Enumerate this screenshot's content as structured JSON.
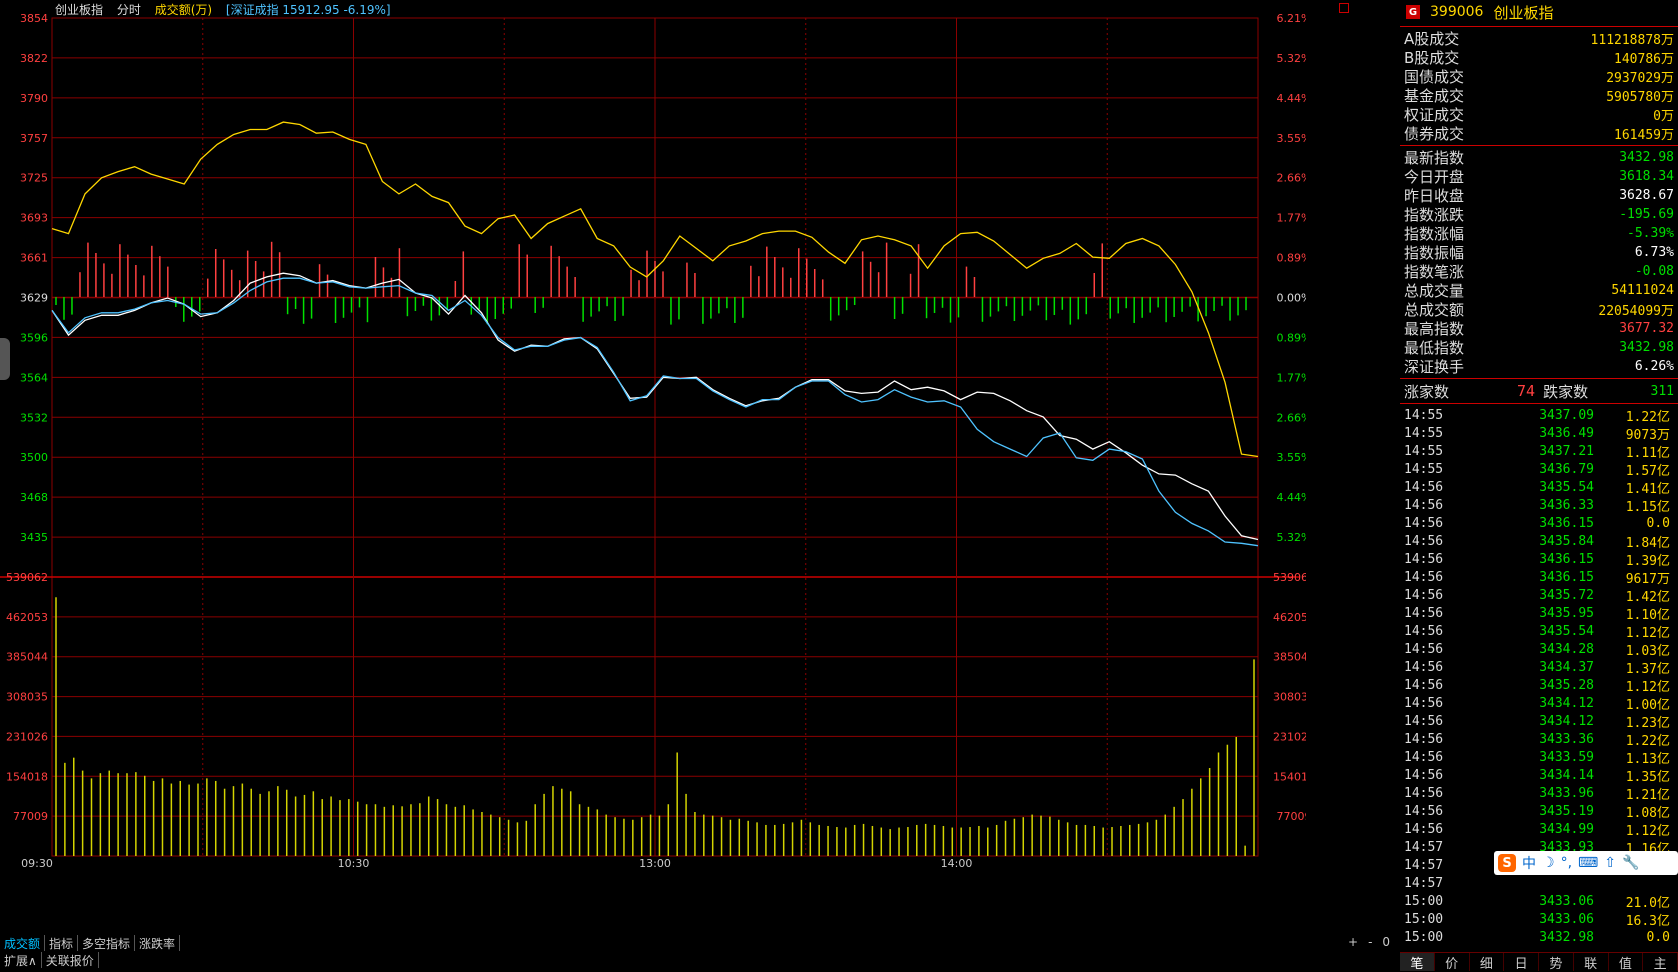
{
  "header": {
    "name": "创业板指",
    "mode": "分时",
    "metric": "成交额(万)",
    "ref": "[深证成指 15912.95 -6.19%]"
  },
  "colors": {
    "up": "#ff4040",
    "down": "#00e000",
    "price": "#ffffff",
    "avg": "#ffd700",
    "ref": "#4fc3ff",
    "grid": "#8b0000"
  },
  "chart_data": {
    "type": "line",
    "ylabel_left_price": [
      "3854",
      "3822",
      "3790",
      "3757",
      "3725",
      "3693",
      "3661",
      "3629",
      "3596",
      "3564",
      "3532",
      "3500",
      "3468",
      "3435"
    ],
    "ylabel_right_pct": [
      "6.21%",
      "5.32%",
      "4.44%",
      "3.55%",
      "2.66%",
      "1.77%",
      "0.89%",
      "0.00%",
      "0.89%",
      "1.77%",
      "2.66%",
      "3.55%",
      "4.44%",
      "5.32%"
    ],
    "vol_axis": [
      "539062",
      "462053",
      "385044",
      "308035",
      "231026",
      "154018",
      "77009"
    ],
    "xticks": [
      "09:30",
      "10:30",
      "13:00",
      "14:00"
    ],
    "prev_close": 3628.67,
    "ylim": [
      3435,
      3854
    ],
    "series": [
      {
        "name": "创业板指",
        "values": [
          3618,
          3598,
          3610,
          3614,
          3614,
          3618,
          3624,
          3628,
          3623,
          3613,
          3616,
          3626,
          3640,
          3645,
          3648,
          3646,
          3640,
          3642,
          3638,
          3636,
          3640,
          3643,
          3632,
          3628,
          3615,
          3630,
          3616,
          3594,
          3585,
          3590,
          3589,
          3595,
          3596,
          3587,
          3567,
          3547,
          3548,
          3564,
          3563,
          3564,
          3554,
          3547,
          3541,
          3545,
          3547,
          3556,
          3562,
          3562,
          3553,
          3551,
          3552,
          3561,
          3554,
          3556,
          3553,
          3546,
          3552,
          3551,
          3545,
          3537,
          3532,
          3517,
          3514,
          3506,
          3512,
          3503,
          3493,
          3486,
          3485,
          3478,
          3472,
          3452,
          3436,
          3433
        ]
      },
      {
        "name": "深证成指",
        "values": [
          3618,
          3600,
          3612,
          3616,
          3616,
          3619,
          3624,
          3626,
          3623,
          3615,
          3616,
          3624,
          3634,
          3641,
          3644,
          3644,
          3640,
          3641,
          3637,
          3636,
          3637,
          3638,
          3632,
          3630,
          3618,
          3626,
          3614,
          3596,
          3586,
          3589,
          3589,
          3594,
          3596,
          3588,
          3568,
          3545,
          3549,
          3565,
          3563,
          3563,
          3553,
          3546,
          3540,
          3546,
          3546,
          3556,
          3561,
          3561,
          3550,
          3544,
          3546,
          3554,
          3548,
          3544,
          3545,
          3540,
          3522,
          3512,
          3506,
          3500,
          3515,
          3519,
          3499,
          3497,
          3506,
          3504,
          3498,
          3472,
          3455,
          3446,
          3440,
          3431,
          3430,
          3428
        ]
      },
      {
        "name": "均价",
        "values": [
          3684,
          3680,
          3712,
          3725,
          3730,
          3734,
          3728,
          3724,
          3720,
          3740,
          3752,
          3760,
          3764,
          3764,
          3770,
          3768,
          3761,
          3762,
          3756,
          3752,
          3722,
          3712,
          3720,
          3710,
          3705,
          3686,
          3680,
          3692,
          3695,
          3676,
          3688,
          3694,
          3700,
          3676,
          3670,
          3653,
          3645,
          3658,
          3678,
          3668,
          3658,
          3670,
          3674,
          3680,
          3682,
          3682,
          3677,
          3665,
          3656,
          3675,
          3678,
          3675,
          3670,
          3652,
          3670,
          3680,
          3681,
          3674,
          3663,
          3652,
          3660,
          3664,
          3672,
          3661,
          3660,
          3672,
          3676,
          3670,
          3655,
          3633,
          3600,
          3560,
          3502,
          3500
        ]
      }
    ],
    "volume": [
      500000,
      180000,
      190000,
      165000,
      150000,
      160000,
      165000,
      160000,
      160000,
      162000,
      155000,
      145000,
      150000,
      140000,
      145000,
      138000,
      140000,
      150000,
      145000,
      130000,
      135000,
      140000,
      130000,
      120000,
      125000,
      135000,
      128000,
      115000,
      118000,
      125000,
      110000,
      115000,
      108000,
      110000,
      105000,
      100000,
      100000,
      95000,
      98000,
      96000,
      100000,
      102000,
      115000,
      110000,
      100000,
      95000,
      98000,
      90000,
      85000,
      80000,
      75000,
      70000,
      65000,
      68000,
      100000,
      120000,
      135000,
      130000,
      125000,
      100000,
      95000,
      90000,
      80000,
      75000,
      72000,
      70000,
      75000,
      80000,
      78000,
      100000,
      200000,
      120000,
      85000,
      80000,
      78000,
      75000,
      70000,
      72000,
      68000,
      65000,
      60000,
      60000,
      62000,
      65000,
      70000,
      65000,
      60000,
      58000,
      56000,
      55000,
      60000,
      62000,
      58000,
      55000,
      52000,
      55000,
      56000,
      60000,
      62000,
      60000,
      58000,
      55000,
      55000,
      56000,
      58000,
      55000,
      60000,
      68000,
      72000,
      75000,
      80000,
      78000,
      76000,
      70000,
      65000,
      60000,
      60000,
      58000,
      55000,
      56000,
      58000,
      60000,
      62000,
      65000,
      70000,
      80000,
      95000,
      110000,
      130000,
      150000,
      170000,
      200000,
      215000,
      230000,
      20000,
      380000
    ]
  },
  "ticker": {
    "code": "399006",
    "name": "创业板指",
    "stats": [
      {
        "label": "A股成交",
        "value": "111218878万",
        "color": "#ffd700"
      },
      {
        "label": "B股成交",
        "value": "140786万",
        "color": "#ffd700"
      },
      {
        "label": "国债成交",
        "value": "2937029万",
        "color": "#ffd700"
      },
      {
        "label": "基金成交",
        "value": "5905780万",
        "color": "#ffd700"
      },
      {
        "label": "权证成交",
        "value": "0万",
        "color": "#ffd700"
      },
      {
        "label": "债券成交",
        "value": "161459万",
        "color": "#ffd700"
      }
    ],
    "quote": [
      {
        "label": "最新指数",
        "value": "3432.98",
        "color": "#00e000"
      },
      {
        "label": "今日开盘",
        "value": "3618.34",
        "color": "#00e000"
      },
      {
        "label": "昨日收盘",
        "value": "3628.67",
        "color": "#ffffff"
      },
      {
        "label": "指数涨跌",
        "value": "-195.69",
        "color": "#00e000"
      },
      {
        "label": "指数涨幅",
        "value": "-5.39%",
        "color": "#00e000"
      },
      {
        "label": "指数振幅",
        "value": "6.73%",
        "color": "#ffffff"
      },
      {
        "label": "指数笔涨",
        "value": "-0.08",
        "color": "#00e000"
      },
      {
        "label": "总成交量",
        "value": "54111024",
        "color": "#ffd700"
      },
      {
        "label": "总成交额",
        "value": "22054099万",
        "color": "#ffd700"
      },
      {
        "label": "最高指数",
        "value": "3677.32",
        "color": "#ff4040"
      },
      {
        "label": "最低指数",
        "value": "3432.98",
        "color": "#00e000"
      },
      {
        "label": "深证换手",
        "value": "6.26%",
        "color": "#ffffff"
      }
    ],
    "up_label": "涨家数",
    "up_count": "74",
    "down_label": "跌家数",
    "down_count": "311",
    "trades": [
      [
        "14:55",
        "3437.09",
        "1.22亿"
      ],
      [
        "14:55",
        "3436.49",
        "9073万"
      ],
      [
        "14:55",
        "3437.21",
        "1.11亿"
      ],
      [
        "14:55",
        "3436.79",
        "1.57亿"
      ],
      [
        "14:56",
        "3435.54",
        "1.41亿"
      ],
      [
        "14:56",
        "3436.33",
        "1.15亿"
      ],
      [
        "14:56",
        "3436.15",
        "0.0"
      ],
      [
        "14:56",
        "3435.84",
        "1.84亿"
      ],
      [
        "14:56",
        "3436.15",
        "1.39亿"
      ],
      [
        "14:56",
        "3436.15",
        "9617万"
      ],
      [
        "14:56",
        "3435.72",
        "1.42亿"
      ],
      [
        "14:56",
        "3435.95",
        "1.10亿"
      ],
      [
        "14:56",
        "3435.54",
        "1.12亿"
      ],
      [
        "14:56",
        "3434.28",
        "1.03亿"
      ],
      [
        "14:56",
        "3434.37",
        "1.37亿"
      ],
      [
        "14:56",
        "3435.28",
        "1.12亿"
      ],
      [
        "14:56",
        "3434.12",
        "1.00亿"
      ],
      [
        "14:56",
        "3434.12",
        "1.23亿"
      ],
      [
        "14:56",
        "3433.36",
        "1.22亿"
      ],
      [
        "14:56",
        "3433.59",
        "1.13亿"
      ],
      [
        "14:56",
        "3434.14",
        "1.35亿"
      ],
      [
        "14:56",
        "3433.96",
        "1.21亿"
      ],
      [
        "14:56",
        "3435.19",
        "1.08亿"
      ],
      [
        "14:56",
        "3434.99",
        "1.12亿"
      ],
      [
        "14:57",
        "3433.93",
        "1.16亿"
      ],
      [
        "14:57",
        "",
        ""
      ],
      [
        "14:57",
        "",
        ""
      ],
      [
        "15:00",
        "3433.06",
        "21.0亿"
      ],
      [
        "15:00",
        "3433.06",
        "16.3亿"
      ],
      [
        "15:00",
        "3432.98",
        "0.0"
      ]
    ],
    "tabs": [
      "笔",
      "价",
      "细",
      "日",
      "势",
      "联",
      "值",
      "主"
    ]
  },
  "bottom_tabs": [
    "成交额",
    "指标",
    "多空指标",
    "涨跌率"
  ],
  "bottom_tabs2": [
    "扩展∧",
    "关联报价"
  ],
  "zoom": [
    "+",
    "-",
    "0"
  ],
  "ime": {
    "badge": "S",
    "items": [
      "中",
      "☽",
      "°,",
      "⌨",
      "⇧",
      "🔧"
    ]
  }
}
